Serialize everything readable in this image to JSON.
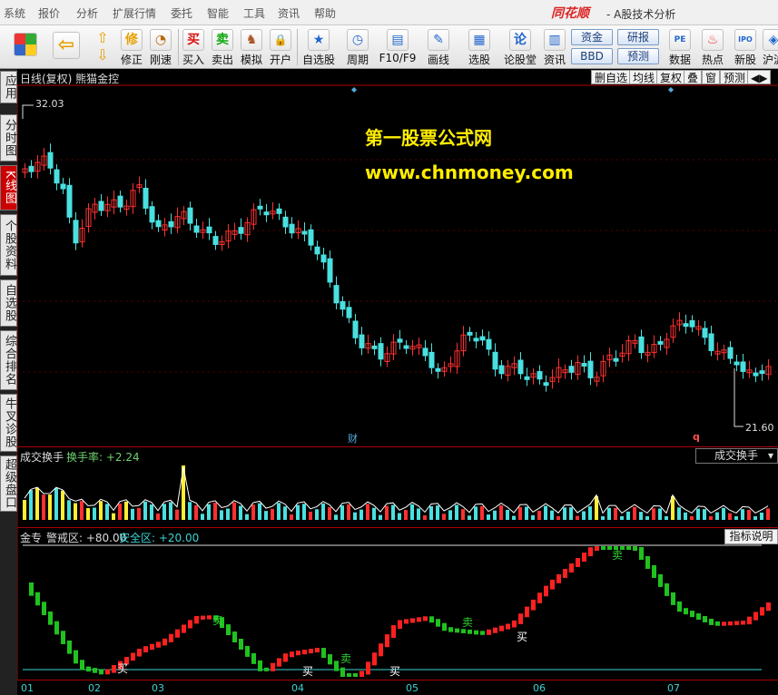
{
  "menu": [
    "系统",
    "报价",
    "分析",
    "扩展行情",
    "委托",
    "智能",
    "工具",
    "资讯",
    "帮助"
  ],
  "brand": "同花顺",
  "app_subtitle": "- A股技术分析",
  "toolbar": {
    "buttons": [
      {
        "label": "修正",
        "icon": "修"
      },
      {
        "label": "刚速",
        "icon": "◔"
      },
      {
        "label": "买入",
        "icon": "买"
      },
      {
        "label": "卖出",
        "icon": "卖"
      },
      {
        "label": "模拟",
        "icon": "♞"
      },
      {
        "label": "开户",
        "icon": "🔒"
      },
      {
        "label": "自选股",
        "icon": "★"
      },
      {
        "label": "周期",
        "icon": "◷"
      },
      {
        "label": "F10/F9",
        "icon": "▤"
      },
      {
        "label": "画线",
        "icon": "✎"
      },
      {
        "label": "选股",
        "icon": "▦"
      },
      {
        "label": "论股堂",
        "icon": "论"
      },
      {
        "label": "资讯",
        "icon": "▥"
      },
      {
        "label": "数据",
        "icon": "PE"
      },
      {
        "label": "热点",
        "icon": "♨"
      },
      {
        "label": "新股",
        "icon": "IPO"
      },
      {
        "label": "沪沪",
        "icon": "◈"
      }
    ],
    "boxes": {
      "zijin": "资金",
      "yanbao": "研报",
      "bbd": "BBD",
      "yuce": "预测"
    }
  },
  "left_tabs": [
    "应用",
    "分时图",
    "K线图",
    "个股资料",
    "自选股",
    "综合排名",
    "牛叉诊股",
    "超级盘口"
  ],
  "stock_header": {
    "title": "日线(复权)  熊猫金控",
    "buttons": [
      "删自选",
      "均线",
      "复权",
      "叠",
      "窗",
      "预测",
      "◀▶"
    ]
  },
  "watermark": {
    "line1": "第一股票公式网",
    "line2": "www.chnmoney.com"
  },
  "price": {
    "high": "32.03",
    "low": "21.60"
  },
  "markers": {
    "cai": "财",
    "q": "q"
  },
  "volume_panel": {
    "title": "成交换手",
    "turnover": "换手率: +2.24",
    "select": "成交换手"
  },
  "indicator_panel": {
    "title": "金专",
    "warning": "警戒区: +80.00",
    "safe": "安全区: +20.00",
    "help": "指标说明",
    "buy": "买",
    "sell": "卖"
  },
  "x_axis": [
    "01",
    "02",
    "03",
    "04",
    "05",
    "06",
    "07"
  ],
  "colors": {
    "up": "#ff3030",
    "down": "#4ae0e0",
    "vol_yellow": "#ffee33",
    "ind_red": "#ff2020",
    "ind_green": "#1fc21f"
  }
}
